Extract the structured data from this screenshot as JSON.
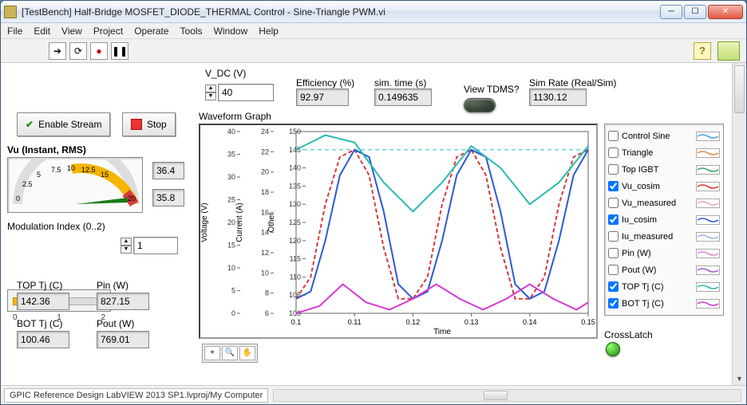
{
  "titlebar": {
    "title": "[TestBench] Half-Bridge MOSFET_DIODE_THERMAL Control - Sine-Triangle PWM.vi"
  },
  "menu": [
    "File",
    "Edit",
    "View",
    "Project",
    "Operate",
    "Tools",
    "Window",
    "Help"
  ],
  "top": {
    "vdc_label": "V_DC (V)",
    "vdc_value": "40",
    "eff_label": "Efficiency (%)",
    "eff_value": "92.97",
    "simtime_label": "sim. time (s)",
    "simtime_value": "0.149635",
    "viewtdms_label": "View TDMS?",
    "simrate_label": "Sim Rate (Real/Sim)",
    "simrate_value": "1130.12"
  },
  "buttons": {
    "enable": "Enable Stream",
    "stop": "Stop"
  },
  "gauge": {
    "label": "Vu (Instant, RMS)",
    "ticks": [
      "0",
      "2.5",
      "5",
      "7.5",
      "10",
      "12.5",
      "15",
      "20"
    ],
    "reading1": "36.4",
    "reading2": "35.8"
  },
  "mod": {
    "label": "Modulation Index (0..2)",
    "value": "1",
    "ticks": [
      "0",
      "1",
      "2"
    ]
  },
  "readouts": {
    "top_tj_label": "TOP Tj (C)",
    "top_tj": "142.36",
    "pin_label": "Pin (W)",
    "pin": "827.15",
    "bot_tj_label": "BOT Tj (C)",
    "bot_tj": "100.46",
    "pout_label": "Pout (W)",
    "pout": "769.01"
  },
  "graph": {
    "title": "Waveform Graph",
    "ylabel1": "Voltage (V)",
    "ylabel2": "Current (A)",
    "ylabel3": "Other",
    "xlabel": "Time"
  },
  "legend": [
    {
      "name": "Control Sine",
      "checked": false,
      "color": "#4aa3e0"
    },
    {
      "name": "Triangle",
      "checked": false,
      "color": "#e08a4a"
    },
    {
      "name": "Top IGBT",
      "checked": false,
      "color": "#3aa06a"
    },
    {
      "name": "Vu_cosim",
      "checked": true,
      "color": "#d43a3a"
    },
    {
      "name": "Vu_measured",
      "checked": false,
      "color": "#e8a8a8"
    },
    {
      "name": "Iu_cosim",
      "checked": true,
      "color": "#2a5ad4"
    },
    {
      "name": "Iu_measured",
      "checked": false,
      "color": "#9ab4e8"
    },
    {
      "name": "Pin (W)",
      "checked": false,
      "color": "#d48ad4"
    },
    {
      "name": "Pout (W)",
      "checked": false,
      "color": "#a25ad4"
    },
    {
      "name": "TOP Tj (C)",
      "checked": true,
      "color": "#2abab0"
    },
    {
      "name": "BOT Tj (C)",
      "checked": true,
      "color": "#d43ad4"
    }
  ],
  "crosslatch_label": "CrossLatch",
  "status": "GPIC Reference Design LabVIEW 2013 SP1.lvproj/My Computer",
  "chart_data": {
    "type": "line",
    "xlabel": "Time",
    "x_range": [
      0.1,
      0.15
    ],
    "x_ticks": [
      0.1,
      0.11,
      0.12,
      0.13,
      0.14,
      0.15
    ],
    "y_axes": [
      {
        "label": "Voltage (V)",
        "range": [
          0,
          40
        ],
        "ticks": [
          0,
          5,
          10,
          15,
          20,
          25,
          30,
          35,
          40
        ]
      },
      {
        "label": "Current (A)",
        "range": [
          6,
          24
        ],
        "ticks": [
          6,
          8,
          10,
          12,
          14,
          16,
          18,
          20,
          22,
          24
        ]
      },
      {
        "label": "Other",
        "range": [
          100,
          150
        ],
        "ticks": [
          100,
          105,
          110,
          115,
          120,
          125,
          130,
          135,
          140,
          145,
          150
        ]
      }
    ],
    "series": [
      {
        "name": "Vu_cosim",
        "axis": 2,
        "color": "#d43a3a",
        "style": "dash",
        "points": [
          [
            0.1,
            104
          ],
          [
            0.1025,
            110
          ],
          [
            0.105,
            130
          ],
          [
            0.1075,
            143
          ],
          [
            0.11,
            145
          ],
          [
            0.1125,
            138
          ],
          [
            0.115,
            118
          ],
          [
            0.1175,
            104
          ],
          [
            0.12,
            104
          ],
          [
            0.1225,
            110
          ],
          [
            0.125,
            130
          ],
          [
            0.1275,
            143
          ],
          [
            0.13,
            145
          ],
          [
            0.1325,
            138
          ],
          [
            0.135,
            118
          ],
          [
            0.1375,
            104
          ],
          [
            0.14,
            104
          ],
          [
            0.1425,
            110
          ],
          [
            0.145,
            130
          ],
          [
            0.1475,
            143
          ],
          [
            0.15,
            145
          ]
        ]
      },
      {
        "name": "Iu_cosim",
        "axis": 2,
        "color": "#2a5ad4",
        "style": "solid",
        "points": [
          [
            0.1,
            104
          ],
          [
            0.1025,
            106
          ],
          [
            0.105,
            120
          ],
          [
            0.1075,
            138
          ],
          [
            0.11,
            145
          ],
          [
            0.1125,
            143
          ],
          [
            0.115,
            128
          ],
          [
            0.1175,
            108
          ],
          [
            0.12,
            104
          ],
          [
            0.1225,
            106
          ],
          [
            0.125,
            120
          ],
          [
            0.1275,
            138
          ],
          [
            0.13,
            145
          ],
          [
            0.1325,
            143
          ],
          [
            0.135,
            128
          ],
          [
            0.1375,
            108
          ],
          [
            0.14,
            104
          ],
          [
            0.1425,
            106
          ],
          [
            0.145,
            120
          ],
          [
            0.1475,
            138
          ],
          [
            0.15,
            145
          ]
        ]
      },
      {
        "name": "TOP Tj (C)",
        "axis": 2,
        "color": "#2abab0",
        "style": "solid",
        "points": [
          [
            0.1,
            145
          ],
          [
            0.105,
            149
          ],
          [
            0.11,
            147
          ],
          [
            0.115,
            136
          ],
          [
            0.12,
            128
          ],
          [
            0.125,
            136
          ],
          [
            0.13,
            146
          ],
          [
            0.135,
            140
          ],
          [
            0.14,
            130
          ],
          [
            0.145,
            136
          ],
          [
            0.15,
            146
          ]
        ]
      },
      {
        "name": "BOT Tj (C)",
        "axis": 2,
        "color": "#d43ad4",
        "style": "solid",
        "points": [
          [
            0.1,
            100
          ],
          [
            0.104,
            102
          ],
          [
            0.108,
            108
          ],
          [
            0.112,
            103
          ],
          [
            0.116,
            101
          ],
          [
            0.12,
            104
          ],
          [
            0.124,
            108
          ],
          [
            0.128,
            104
          ],
          [
            0.132,
            101
          ],
          [
            0.136,
            104
          ],
          [
            0.14,
            108
          ],
          [
            0.144,
            104
          ],
          [
            0.148,
            101
          ],
          [
            0.15,
            103
          ]
        ]
      }
    ],
    "hline": {
      "axis": 2,
      "y": 145,
      "color": "#5acfd4",
      "style": "dash"
    }
  }
}
